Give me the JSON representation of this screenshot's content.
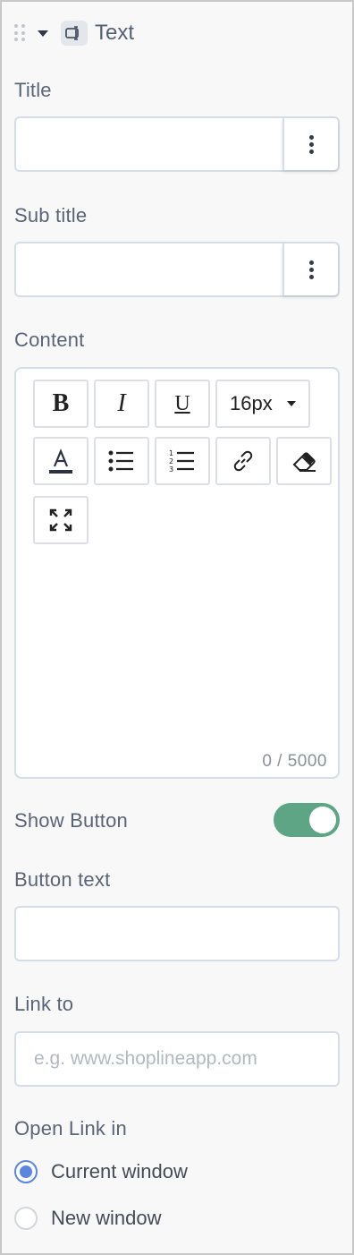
{
  "header": {
    "title": "Text",
    "block_icon": "text-block-icon"
  },
  "title_field": {
    "label": "Title",
    "value": ""
  },
  "subtitle_field": {
    "label": "Sub title",
    "value": ""
  },
  "content": {
    "label": "Content",
    "toolbar": {
      "bold": "B",
      "italic": "I",
      "underline": "U",
      "font_size": "16px"
    },
    "counter": "0 / 5000"
  },
  "show_button": {
    "label": "Show Button",
    "enabled": true
  },
  "button_text": {
    "label": "Button text",
    "value": ""
  },
  "link_to": {
    "label": "Link to",
    "placeholder": "e.g. www.shoplineapp.com"
  },
  "open_link_in": {
    "label": "Open Link in",
    "options": [
      {
        "label": "Current window",
        "selected": true
      },
      {
        "label": "New window",
        "selected": false
      }
    ]
  },
  "colors": {
    "toggle_on": "#5ea586",
    "radio_selected": "#5b86e0"
  }
}
